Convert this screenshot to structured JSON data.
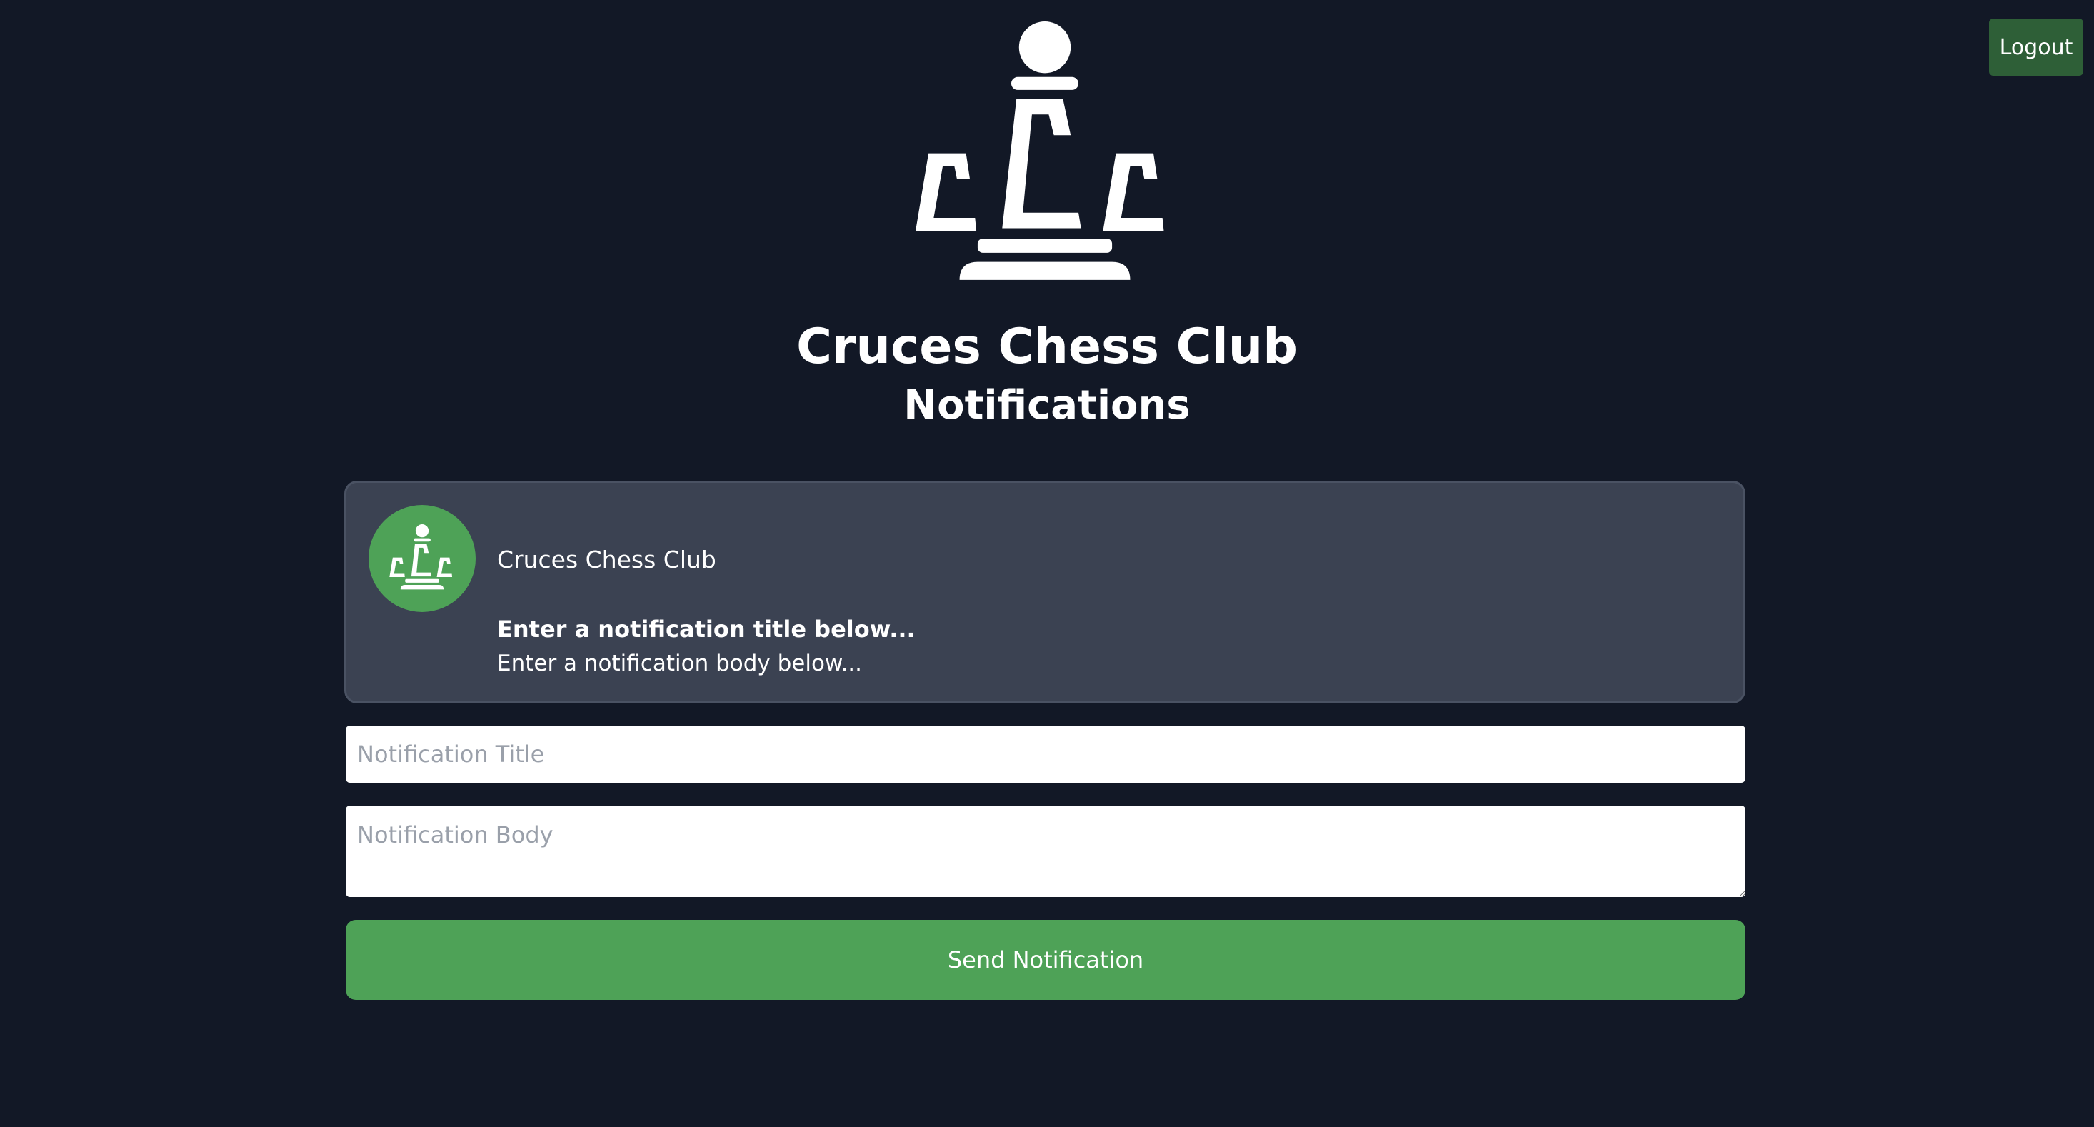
{
  "header": {
    "logout_label": "Logout",
    "club_name": "Cruces Chess Club",
    "page_subtitle": "Notifications"
  },
  "preview": {
    "sender": "Cruces Chess Club",
    "title": "Enter a notification title below...",
    "body": "Enter a notification body below..."
  },
  "form": {
    "title_placeholder": "Notification Title",
    "title_value": "",
    "body_placeholder": "Notification Body",
    "body_value": "",
    "send_label": "Send Notification"
  },
  "icons": {
    "logo": "chess-pawn-ccc-logo-icon",
    "avatar": "chess-pawn-ccc-logo-icon"
  },
  "colors": {
    "background": "#121826",
    "card": "#3b4252",
    "accent_green": "#4ea257",
    "logout_green": "#2e5f37"
  }
}
